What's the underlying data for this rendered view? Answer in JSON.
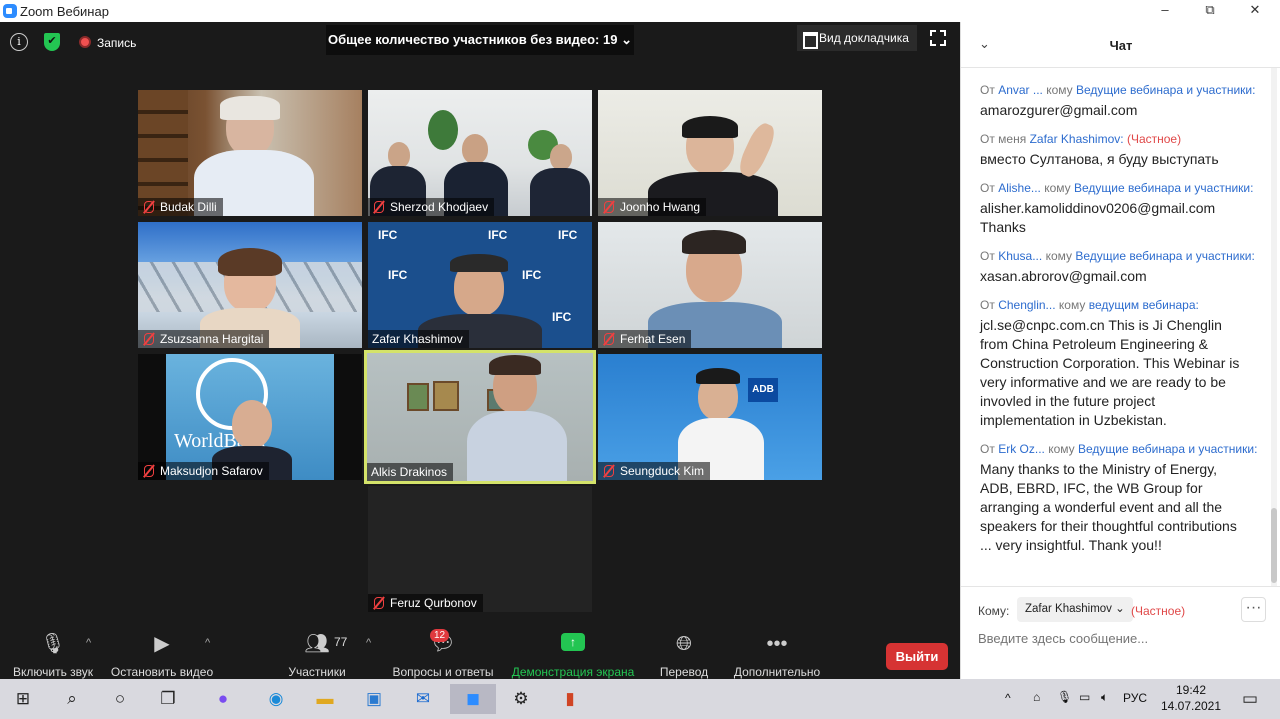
{
  "window": {
    "title": "Zoom Вебинар",
    "minimize": "‒",
    "maximize": "⧉",
    "close": "✕"
  },
  "topbar": {
    "info_icon": "i",
    "security_icon": "✔",
    "record_label": "Запись",
    "nonvideo_label": "Общее количество участников без видео: 19",
    "nonvideo_caret": "⌄",
    "view_label": "Вид докладчика"
  },
  "participants": [
    {
      "name": "Budak Dilli"
    },
    {
      "name": "Sherzod Khodjaev"
    },
    {
      "name": "Joonho Hwang"
    },
    {
      "name": "Zsuzsanna Hargitai"
    },
    {
      "name": "Zafar Khashimov"
    },
    {
      "name": "Ferhat Esen"
    },
    {
      "name": "Maksudjon Safarov"
    },
    {
      "name": "Alkis Drakinos"
    },
    {
      "name": "Seungduck Kim"
    },
    {
      "name": "Feruz Qurbonov"
    }
  ],
  "tile_labels": {
    "ifc": "IFC",
    "adb": "ADB",
    "worldbank": "WorldBank"
  },
  "toolbar": {
    "audio": "Включить звук",
    "video": "Остановить видео",
    "participants": "Участники",
    "participants_count": "77",
    "qa": "Вопросы и ответы",
    "qa_badge": "12",
    "share": "Демонстрация экрана",
    "translate": "Перевод",
    "more": "Дополнительно",
    "exit": "Выйти",
    "caret": "^"
  },
  "colors": {
    "share_green": "#23c552",
    "exit_red": "#d63333",
    "link_blue": "#2d6cce",
    "private_red": "#e04848"
  },
  "chat": {
    "title": "Чат",
    "collapse_icon": "⌄",
    "messages": [
      {
        "from_prefix": "От",
        "from": "Anvar ...",
        "to_prefix": "кому",
        "to": "Ведущие вебинара и участники:",
        "private": "",
        "text": "amarozgurer@gmail.com"
      },
      {
        "from_prefix": "От меня",
        "from": "Zafar Khashimov:",
        "to_prefix": "",
        "to": "",
        "private": "(Частное)",
        "text": "вместо Султанова, я буду выступать"
      },
      {
        "from_prefix": "От",
        "from": "Alishe...",
        "to_prefix": "кому",
        "to": "Ведущие вебинара и участники:",
        "private": "",
        "text": "alisher.kamoliddinov0206@gmail.com Thanks"
      },
      {
        "from_prefix": "От",
        "from": "Khusa...",
        "to_prefix": "кому",
        "to": "Ведущие вебинара и участники:",
        "private": "",
        "text": "xasan.abrorov@gmail.com"
      },
      {
        "from_prefix": "От",
        "from": "Chenglin...",
        "to_prefix": "кому",
        "to": "ведущим вебинара:",
        "private": "",
        "text": "jcl.se@cnpc.com.cn This is Ji Chenglin from China Petroleum Engineering & Construction Corporation. This Webinar is very informative and  we are ready to be invovled in the future project implementation in Uzbekistan."
      },
      {
        "from_prefix": "От",
        "from": "Erk Oz...",
        "to_prefix": "кому",
        "to": "Ведущие вебинара и участники:",
        "private": "",
        "text": "Many thanks to the Ministry of Energy, ADB, EBRD, IFC, the WB Group for arranging a wonderful event and all the speakers for their thoughtful contributions ... very insightful. Thank you!!"
      }
    ],
    "to_label": "Кому:",
    "recipient": "Zafar Khashimov ⌄",
    "private_label": "(Частное)",
    "more_label": "···",
    "input_placeholder": "Введите здесь сообщение..."
  },
  "taskbar": {
    "tray_up": "^",
    "language": "РУС",
    "time": "19:42",
    "date": "14.07.2021"
  }
}
